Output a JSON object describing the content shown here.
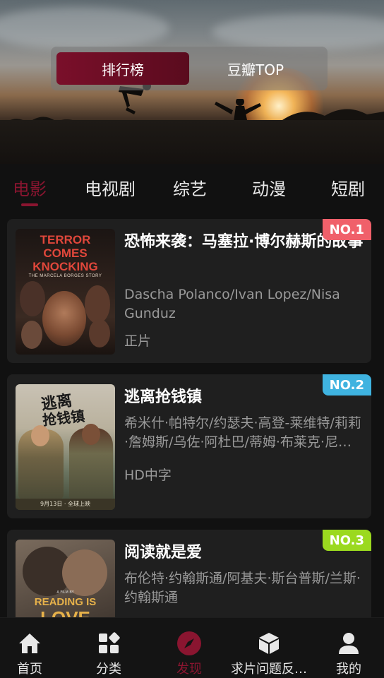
{
  "hero": {
    "segments": [
      {
        "label": "排行榜",
        "active": true
      },
      {
        "label": "豆瓣TOP",
        "active": false
      }
    ]
  },
  "tabs": [
    {
      "label": "电影",
      "active": true
    },
    {
      "label": "电视剧",
      "active": false
    },
    {
      "label": "综艺",
      "active": false
    },
    {
      "label": "动漫",
      "active": false
    },
    {
      "label": "短剧",
      "active": false
    }
  ],
  "movies": [
    {
      "rank": "NO.1",
      "rank_color": "#f0606a",
      "title": "恐怖来袭：马塞拉·博尔赫斯的故事",
      "cast": "Dascha Polanco/Ivan Lopez/Nisa Gunduz",
      "quality": "正片",
      "poster": {
        "line1": "TERROR",
        "line2": "COMES",
        "line3": "KNOCKING",
        "subtitle": "THE MARCELA BORGES STORY"
      }
    },
    {
      "rank": "NO.2",
      "rank_color": "#3fb3e0",
      "title": "逃离抢钱镇",
      "cast": "希米什·帕特尔/约瑟夫·高登-莱维特/莉莉·詹姆斯/乌佐·阿杜巴/蒂姆·布莱克·尼尔森",
      "quality": "HD中字",
      "poster": {
        "calligraphy_1": "逃离",
        "calligraphy_2": "抢钱镇",
        "footer": "9月13日 · 全球上映"
      }
    },
    {
      "rank": "NO.3",
      "rank_color": "#9bd91f",
      "title": "阅读就是爱",
      "cast": "布伦特·约翰斯通/阿基夫·斯台普斯/兰斯·约翰斯通",
      "quality": "",
      "poster": {
        "line1": "READING IS",
        "line2": "LOVE",
        "credit": "A FILM BY"
      }
    }
  ],
  "bottom_nav": [
    {
      "label": "首页",
      "icon": "home-icon",
      "active": false
    },
    {
      "label": "分类",
      "icon": "category-icon",
      "active": false
    },
    {
      "label": "发现",
      "icon": "compass-icon",
      "active": true
    },
    {
      "label": "求片问题反…",
      "icon": "cube-icon",
      "active": false
    },
    {
      "label": "我的",
      "icon": "user-icon",
      "active": false
    }
  ],
  "colors": {
    "accent": "#8a1530",
    "card_bg": "#1f1f1f",
    "page_bg": "#111111"
  }
}
